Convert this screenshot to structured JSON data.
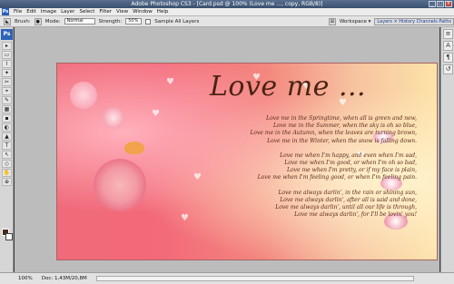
{
  "app": {
    "title": "Adobe Photoshop CS3 - [Card.psd @ 100% (Love me ..., copy, RGB/8)]"
  },
  "menubar": {
    "logo": "Ps",
    "items": [
      "File",
      "Edit",
      "Image",
      "Layer",
      "Select",
      "Filter",
      "View",
      "Window",
      "Help"
    ]
  },
  "options": {
    "brush_label": "Brush:",
    "brush_value": "●",
    "mode_label": "Mode:",
    "mode_value": "Normal",
    "strength_label": "Strength:",
    "strength_value": "50%",
    "sample_all_layers_label": "Sample All Layers",
    "workspace_label": "Workspace ▾",
    "panel_tabs": "Layers ×  History  Channels  Paths"
  },
  "toolbox": {
    "logo": "Ps",
    "tools": [
      "▸",
      "▭",
      "⌇",
      "✦",
      "✂",
      "⌖",
      "✎",
      "▦",
      "▪",
      "◐",
      "▲",
      "T",
      "↖",
      "◇",
      "✋",
      "⊕"
    ]
  },
  "rightdock": {
    "icons": [
      "≡",
      "A",
      "¶",
      "↺"
    ]
  },
  "document": {
    "title": "Love me ...",
    "stanzas": [
      [
        "Love me in the Springtime, when all is green and new,",
        "Love me in the Summer, when the sky is oh so blue,",
        "Love me in the Autumn, when the leaves are turning brown,",
        "Love me in the Winter, when the snow is falling down."
      ],
      [
        "Love me when I'm happy, and even when I'm sad,",
        "Love me when I'm good, or when I'm oh so bad,",
        "Love me when I'm pretty, or if my face is plain,",
        "Love me when I'm feeling good, or when I'm feeling pain."
      ],
      [
        "Love me always darlin', in the rain or shining sun,",
        "Love me always darlin', after all is said and done,",
        "Love me always darlin', until all our life is through,",
        "Love me always darlin', for I'll be lovin' you!"
      ]
    ]
  },
  "status": {
    "zoom": "100%",
    "doc": "Doc: 1,43M/20,8M"
  },
  "colors": {
    "foreground": "#4a2a19",
    "background": "#ffffff"
  }
}
